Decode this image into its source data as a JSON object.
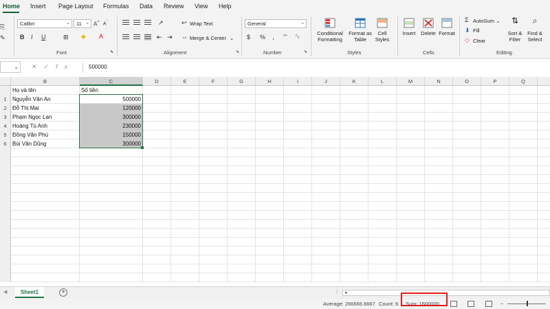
{
  "menu": {
    "tabs": [
      "Home",
      "Insert",
      "Page Layout",
      "Formulas",
      "Data",
      "Review",
      "View",
      "Help"
    ]
  },
  "ribbon": {
    "font": {
      "name": "Calibri",
      "size": "11",
      "group_label": "Font"
    },
    "alignment": {
      "wrap_text": "Wrap Text",
      "merge_center": "Merge & Center",
      "group_label": "Alignment"
    },
    "number": {
      "format": "General",
      "group_label": "Number"
    },
    "styles": {
      "conditional_formatting": "Conditional Formatting",
      "format_as_table": "Format as Table",
      "cell_styles": "Cell Styles",
      "group_label": "Styles"
    },
    "cells": {
      "insert": "Insert",
      "delete": "Delete",
      "format": "Format",
      "group_label": "Cells"
    },
    "editing": {
      "autosum": "AutoSum",
      "fill": "Fill",
      "clear": "Clear",
      "sort_filter": "Sort & Filter",
      "find_select": "Find & Select",
      "group_label": "Editing"
    }
  },
  "formula_bar": {
    "value": "500000"
  },
  "columns": [
    "B",
    "C",
    "D",
    "E",
    "F",
    "G",
    "H",
    "I",
    "J",
    "K",
    "L",
    "M",
    "N",
    "O",
    "P",
    "Q"
  ],
  "table": {
    "header": {
      "name": "Họ và tên",
      "amount": "Số tiền"
    },
    "rows": [
      {
        "num": "1",
        "name": "Nguyễn Văn An",
        "amount": "500000"
      },
      {
        "num": "2",
        "name": "Đỗ Thị Mai",
        "amount": "120000"
      },
      {
        "num": "3",
        "name": "Phạm Ngọc Lan",
        "amount": "300000"
      },
      {
        "num": "4",
        "name": "Hoàng Tú Anh",
        "amount": "230000"
      },
      {
        "num": "5",
        "name": "Đồng Văn Phú",
        "amount": "150000"
      },
      {
        "num": "6",
        "name": "Bùi Văn Dũng",
        "amount": "300000"
      }
    ]
  },
  "sheet_tab": "Sheet1",
  "status": {
    "average": "Average: 266666.6667",
    "count": "Count: 6",
    "sum": "Sum: 1600000"
  },
  "colors": {
    "accent": "#217346",
    "highlight": "#e01b1b",
    "selection_fill": "#c8c8c8"
  }
}
